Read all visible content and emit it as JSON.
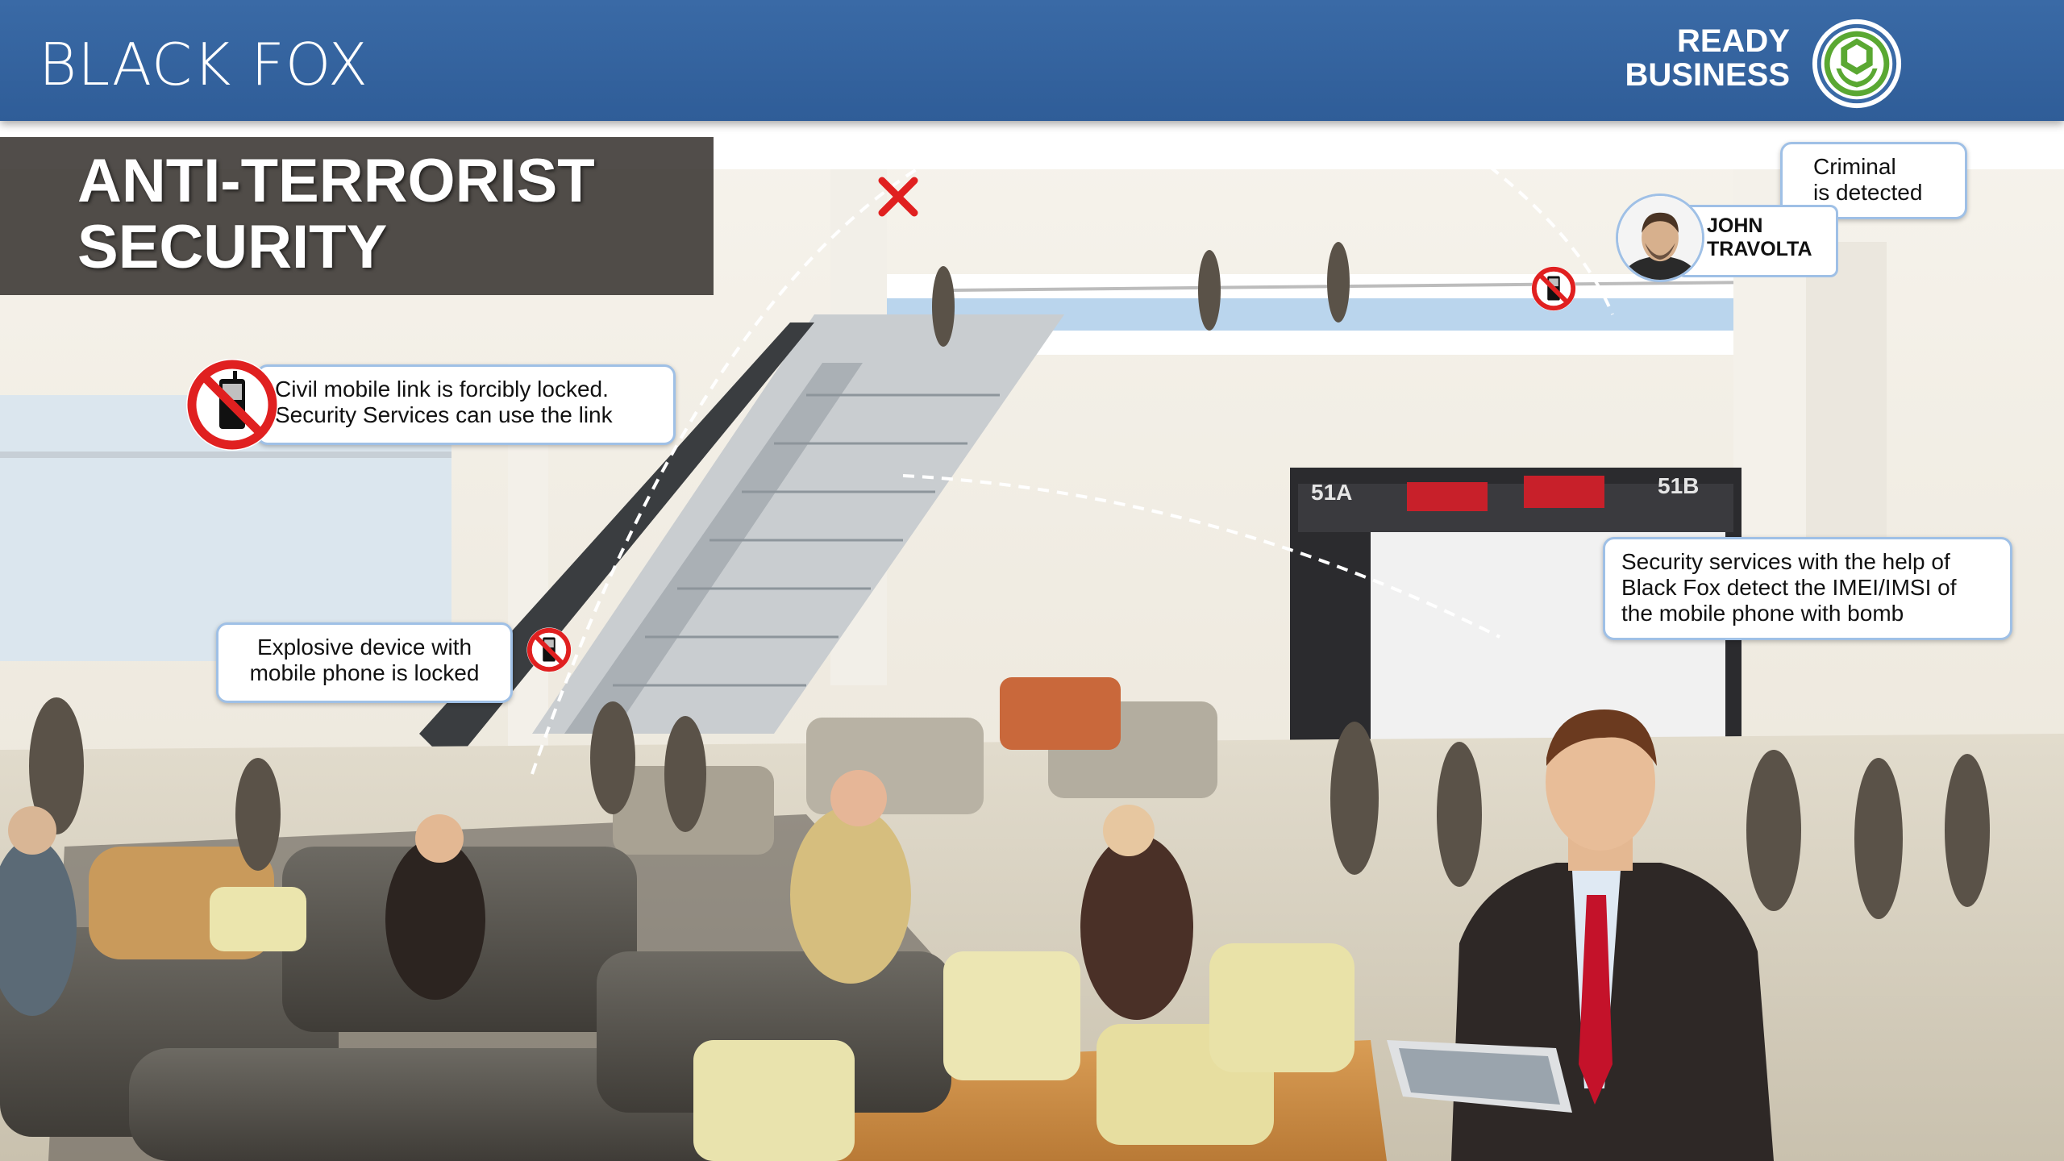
{
  "header": {
    "brand": "BLACK FOX",
    "badge_line1": "READY",
    "badge_line2": "BUSINESS"
  },
  "title": {
    "line1": "ANTI-TERRORIST",
    "line2": "SECURITY"
  },
  "callouts": {
    "civil_link": "Civil mobile link is forcibly locked.\nSecurity Services can use the link",
    "explosive": "Explosive device with\nmobile phone is locked",
    "criminal": "Criminal\nis detected",
    "security_services": "Security services with the help of\nBlack Fox detect the IMEI/IMSI of\nthe mobile phone with bomb",
    "suspect_name": "JOHN\nTRAVOLTA"
  },
  "gates": {
    "left": "51A",
    "right": "51B"
  },
  "colors": {
    "header_blue": "#2f5d98",
    "callout_border": "#9fc0e6",
    "title_panel": "#3e3a36",
    "warning_red": "#e02020"
  },
  "icons": [
    "no-mobile-phone-icon",
    "red-x-icon",
    "ready-business-badge-icon",
    "suspect-avatar"
  ]
}
